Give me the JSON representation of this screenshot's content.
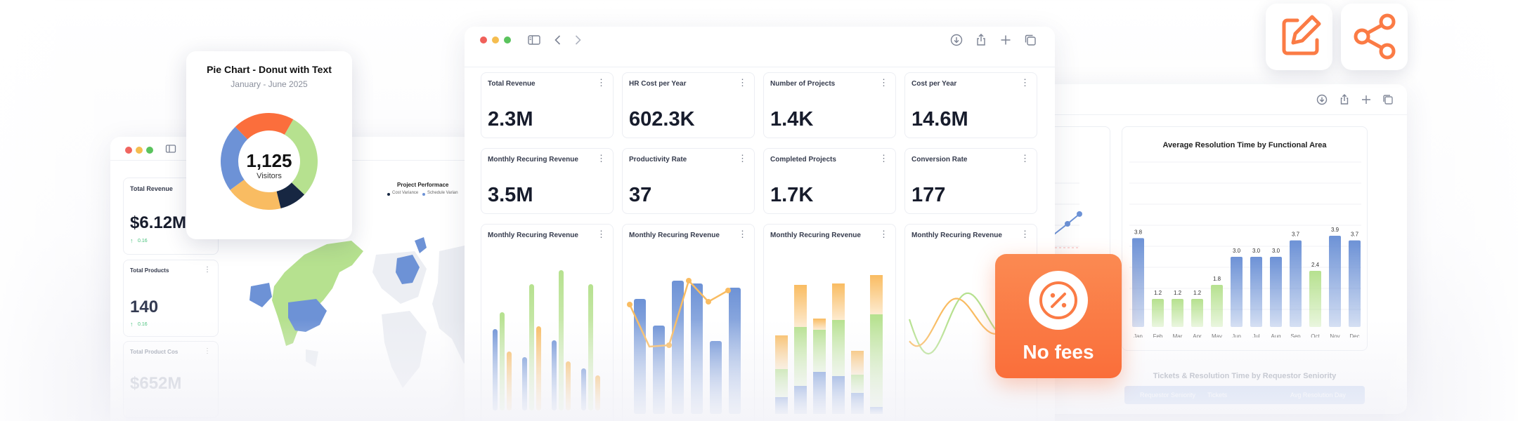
{
  "colors": {
    "blue": "#6d92d6",
    "green": "#b6e18f",
    "orange": "#fb6e3c",
    "amber": "#f9bc62",
    "navy": "#172742",
    "promo": "#fb7b45"
  },
  "left_window": {
    "cards": [
      {
        "label": "Total Revenue",
        "value": "$6.12M",
        "delta": "0.16"
      },
      {
        "label": "Total Products",
        "value": "140",
        "delta": "0.16"
      },
      {
        "label": "Total Product Cos",
        "value": "$652M"
      }
    ],
    "map": {
      "title": "Project Performace",
      "legend": [
        "Cost Variance",
        "Schedule Varian"
      ]
    }
  },
  "pie_popup": {
    "title": "Pie Chart - Donut with Text",
    "subtitle": "January - June 2025",
    "center_value": "1,125",
    "center_label": "Visitors",
    "chart_data": {
      "type": "pie",
      "title": "Pie Chart - Donut with Text",
      "values": [
        {
          "value": 95,
          "color": "#b6e18f"
        },
        {
          "value": 30,
          "color": "#172742"
        },
        {
          "value": 62,
          "color": "#f9bc62"
        },
        {
          "value": 75,
          "color": "#6d92d6"
        },
        {
          "value": 68,
          "color": "#fb6e3c"
        }
      ]
    }
  },
  "main_window": {
    "kpis": [
      {
        "label": "Total Revenue",
        "value": "2.3M"
      },
      {
        "label": "HR Cost per Year",
        "value": "602.3K"
      },
      {
        "label": "Number of Projects",
        "value": "1.4K"
      },
      {
        "label": "Cost per Year",
        "value": "14.6M"
      },
      {
        "label": "Monthly Recuring Revenue",
        "value": "3.5M"
      },
      {
        "label": "Productivity Rate",
        "value": "37"
      },
      {
        "label": "Completed Projects",
        "value": "1.7K"
      },
      {
        "label": "Conversion Rate",
        "value": "177"
      }
    ],
    "charts": [
      {
        "label": "Monthly Recuring Revenue"
      },
      {
        "label": "Monthly Recuring Revenue"
      },
      {
        "label": "Monthly Recuring Revenue"
      },
      {
        "label": "Monthly Recuring Revenue"
      }
    ]
  },
  "chart_data": [
    {
      "type": "bar",
      "ylim": [
        0,
        100
      ],
      "series": [
        {
          "color": "#6d92d6",
          "values": [
            58,
            38,
            50,
            30
          ]
        },
        {
          "color": "#b6e18f",
          "values": [
            70,
            90,
            100,
            90
          ]
        },
        {
          "color": "#f9bc62",
          "values": [
            42,
            60,
            35,
            25
          ]
        }
      ]
    },
    {
      "type": "bar",
      "ylim": [
        0,
        100
      ],
      "values": [
        82,
        63,
        95,
        93,
        52,
        90
      ],
      "line": [
        78,
        48,
        49,
        95,
        80,
        88
      ]
    },
    {
      "type": "bar",
      "ylim": [
        0,
        100
      ],
      "stacks": [
        {
          "blue": 12,
          "green": 20,
          "amber": 24
        },
        {
          "blue": 20,
          "green": 42,
          "amber": 30
        },
        {
          "blue": 30,
          "green": 30,
          "amber": 8
        },
        {
          "blue": 27,
          "green": 40,
          "amber": 26
        },
        {
          "blue": 15,
          "green": 13,
          "amber": 17
        },
        {
          "blue": 5,
          "green": 66,
          "amber": 28
        }
      ]
    },
    {
      "type": "line",
      "ylim": [
        0,
        100
      ],
      "series": [
        {
          "color": "#b6e18f"
        },
        {
          "color": "#f9bc62"
        }
      ]
    },
    {
      "type": "bar",
      "title": "Average Resolution Time by Functional Area",
      "categories": [
        "Jan",
        "Feb",
        "Mar",
        "Apr",
        "May",
        "Jun",
        "Jul",
        "Aug",
        "Sep",
        "Oct",
        "Nov",
        "Dec"
      ],
      "values": [
        3.8,
        1.2,
        1.2,
        1.2,
        1.8,
        3.0,
        3.0,
        3.0,
        3.7,
        2.4,
        3.9,
        3.7
      ],
      "labels": [
        "3.8",
        "1.2",
        "1.2",
        "1.2",
        "1.8",
        "3.0",
        "3.0",
        "3.0",
        "3.7",
        "2.4",
        "3.9",
        "3.7"
      ],
      "bar_colors": [
        "#6d92d6",
        "#b6e18f",
        "#b6e18f",
        "#b6e18f",
        "#b6e18f",
        "#6d92d6",
        "#6d92d6",
        "#6d92d6",
        "#6d92d6",
        "#b6e18f",
        "#6d92d6",
        "#6d92d6"
      ],
      "ylim": [
        0,
        4.5
      ]
    }
  ],
  "right_window": {
    "partial_text": "rnde",
    "title": "Average Resolution Time by Functional Area",
    "table_title": "Tickets & Resolution Time by Requestor Seniority",
    "table_headers": [
      "Requestor Seniority",
      "Tickets",
      "Avg Resolution Day"
    ]
  },
  "promo": {
    "label": "No fees"
  },
  "actions": [
    {
      "icon": "edit-icon"
    },
    {
      "icon": "share-icon"
    }
  ]
}
